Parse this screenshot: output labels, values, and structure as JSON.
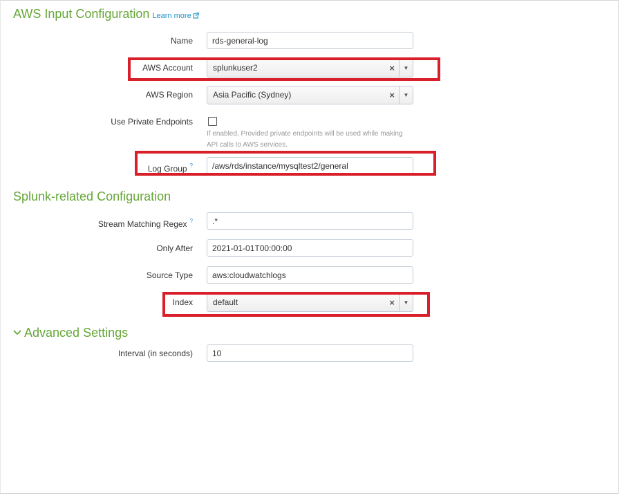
{
  "sections": {
    "aws_input": {
      "title": "AWS Input Configuration",
      "learn_more": "Learn more"
    },
    "splunk": {
      "title": "Splunk-related Configuration"
    },
    "advanced": {
      "title": "Advanced Settings"
    }
  },
  "fields": {
    "name": {
      "label": "Name",
      "value": "rds-general-log"
    },
    "aws_account": {
      "label": "AWS Account",
      "value": "splunkuser2"
    },
    "aws_region": {
      "label": "AWS Region",
      "value": "Asia Pacific (Sydney)"
    },
    "private_endpoints": {
      "label": "Use Private Endpoints",
      "checked": false,
      "help_line1": "If enabled, Provided private endpoints will be used while making",
      "help_line2": "API calls to AWS services."
    },
    "log_group": {
      "label": "Log Group",
      "value": "/aws/rds/instance/mysqltest2/general",
      "help": "?"
    },
    "stream_regex": {
      "label": "Stream Matching Regex",
      "value": ".*",
      "help": "?"
    },
    "only_after": {
      "label": "Only After",
      "value": "2021-01-01T00:00:00"
    },
    "source_type": {
      "label": "Source Type",
      "value": "aws:cloudwatchlogs"
    },
    "index": {
      "label": "Index",
      "value": "default"
    },
    "interval": {
      "label": "Interval (in seconds)",
      "value": "10"
    }
  },
  "icons": {
    "clear": "×",
    "dropdown": "▼"
  },
  "colors": {
    "accent_green": "#65a637",
    "link_blue": "#1e93c6",
    "highlight_red": "#d9202a"
  }
}
